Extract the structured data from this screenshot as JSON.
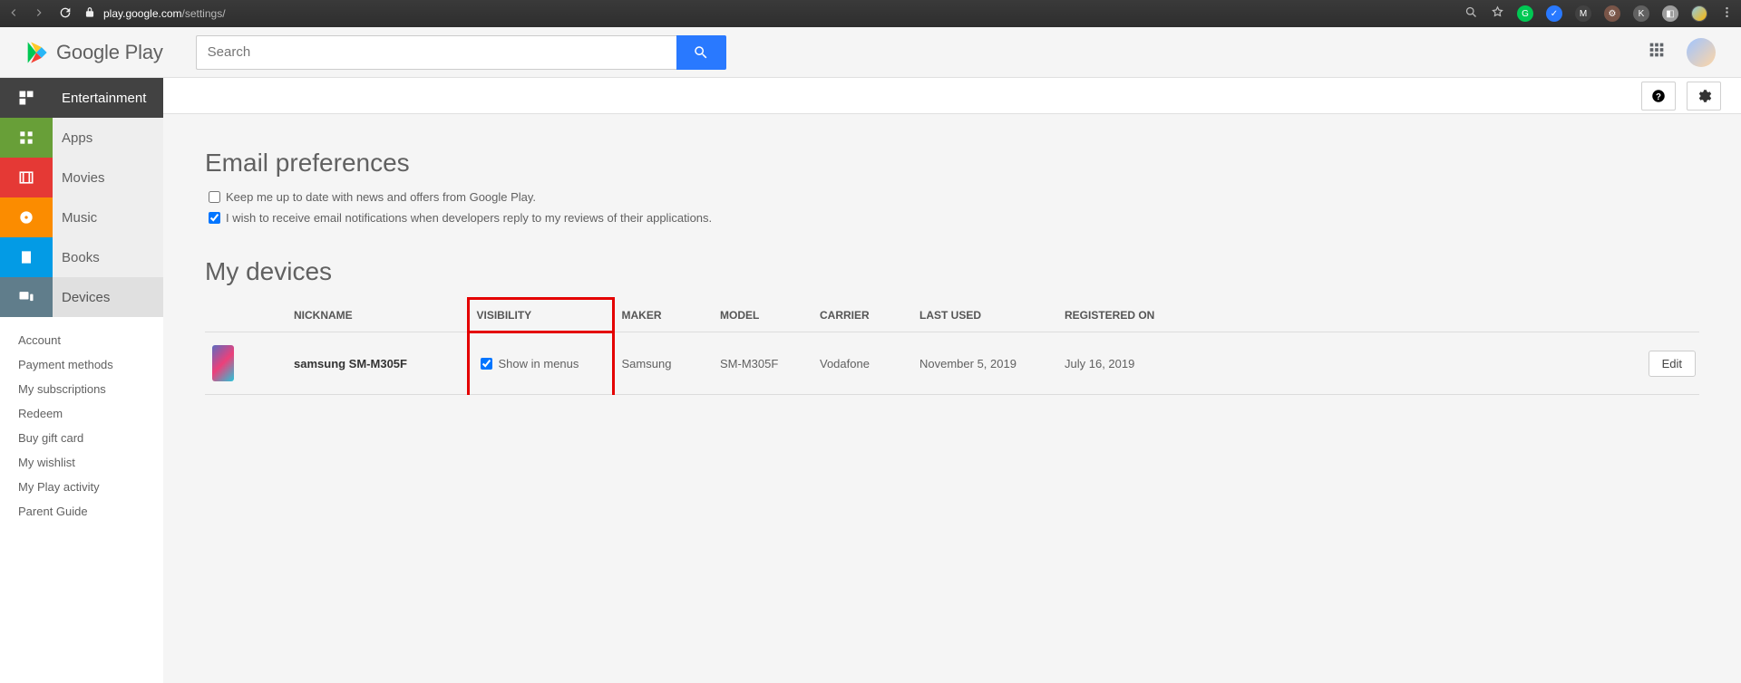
{
  "browser": {
    "url_host": "play.google.com",
    "url_path": "/settings/"
  },
  "header": {
    "logo_text": "Google Play",
    "search_placeholder": "Search"
  },
  "sidebar": {
    "main_nav": {
      "entertainment": "Entertainment",
      "apps": "Apps",
      "movies": "Movies",
      "music": "Music",
      "books": "Books",
      "devices": "Devices"
    },
    "sublinks": {
      "account": "Account",
      "payment": "Payment methods",
      "subs": "My subscriptions",
      "redeem": "Redeem",
      "giftcard": "Buy gift card",
      "wishlist": "My wishlist",
      "activity": "My Play activity",
      "parent": "Parent Guide"
    }
  },
  "content": {
    "email_prefs_title": "Email preferences",
    "pref1_label": "Keep me up to date with news and offers from Google Play.",
    "pref2_label": "I wish to receive email notifications when developers reply to my reviews of their applications.",
    "devices_title": "My devices",
    "table_headers": {
      "nickname": "NICKNAME",
      "visibility": "VISIBILITY",
      "maker": "MAKER",
      "model": "MODEL",
      "carrier": "CARRIER",
      "last_used": "LAST USED",
      "registered": "REGISTERED ON"
    },
    "device": {
      "nickname": "samsung SM-M305F",
      "visibility_label": "Show in menus",
      "maker": "Samsung",
      "model": "SM-M305F",
      "carrier": "Vodafone",
      "last_used": "November 5, 2019",
      "registered": "July 16, 2019",
      "edit_label": "Edit"
    }
  }
}
